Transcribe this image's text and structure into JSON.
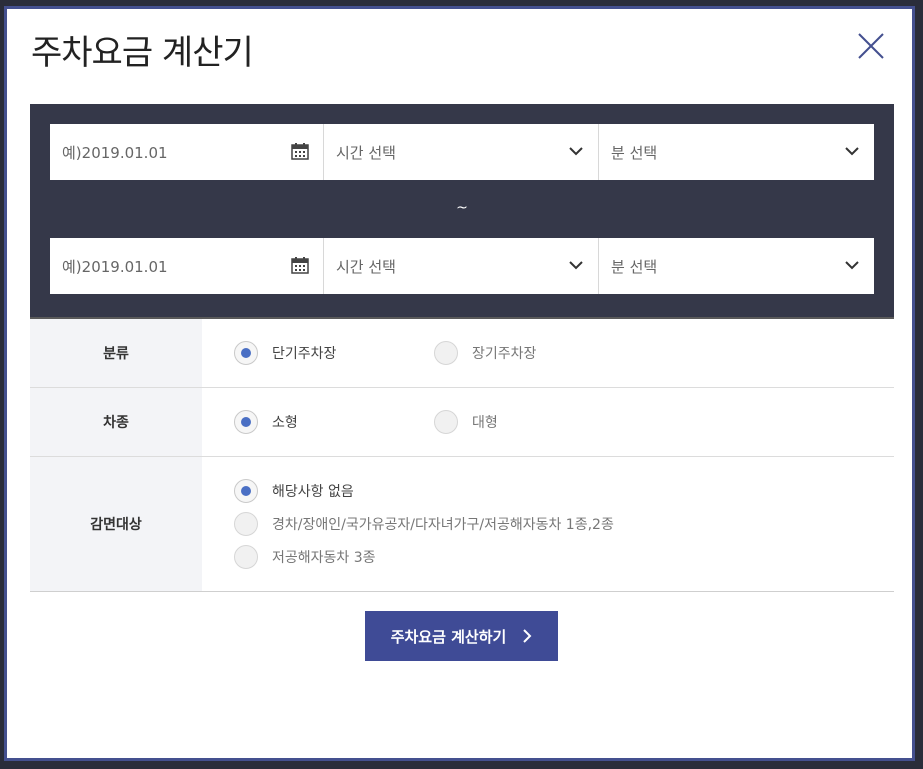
{
  "modal": {
    "title": "주차요금 계산기",
    "close_icon": "close-icon"
  },
  "period": {
    "start": {
      "date_placeholder": "예)2019.01.01",
      "hour_label": "시간 선택",
      "minute_label": "분 선택"
    },
    "separator": "~",
    "end": {
      "date_placeholder": "예)2019.01.01",
      "hour_label": "시간 선택",
      "minute_label": "분 선택"
    }
  },
  "options": {
    "category": {
      "label": "분류",
      "choices": [
        {
          "label": "단기주차장",
          "selected": true
        },
        {
          "label": "장기주차장",
          "selected": false
        }
      ]
    },
    "vehicle": {
      "label": "차종",
      "choices": [
        {
          "label": "소형",
          "selected": true
        },
        {
          "label": "대형",
          "selected": false
        }
      ]
    },
    "discount": {
      "label": "감면대상",
      "choices": [
        {
          "label": "해당사항 없음",
          "selected": true
        },
        {
          "label": "경차/장애인/국가유공자/다자녀가구/저공해자동차 1종,2종",
          "selected": false
        },
        {
          "label": "저공해자동차 3종",
          "selected": false
        }
      ]
    }
  },
  "submit": {
    "label": "주차요금 계산하기"
  },
  "colors": {
    "accent": "#3f4b96",
    "panel": "#353849",
    "radio_dot": "#4a6fc4",
    "frame": "#44508f"
  }
}
